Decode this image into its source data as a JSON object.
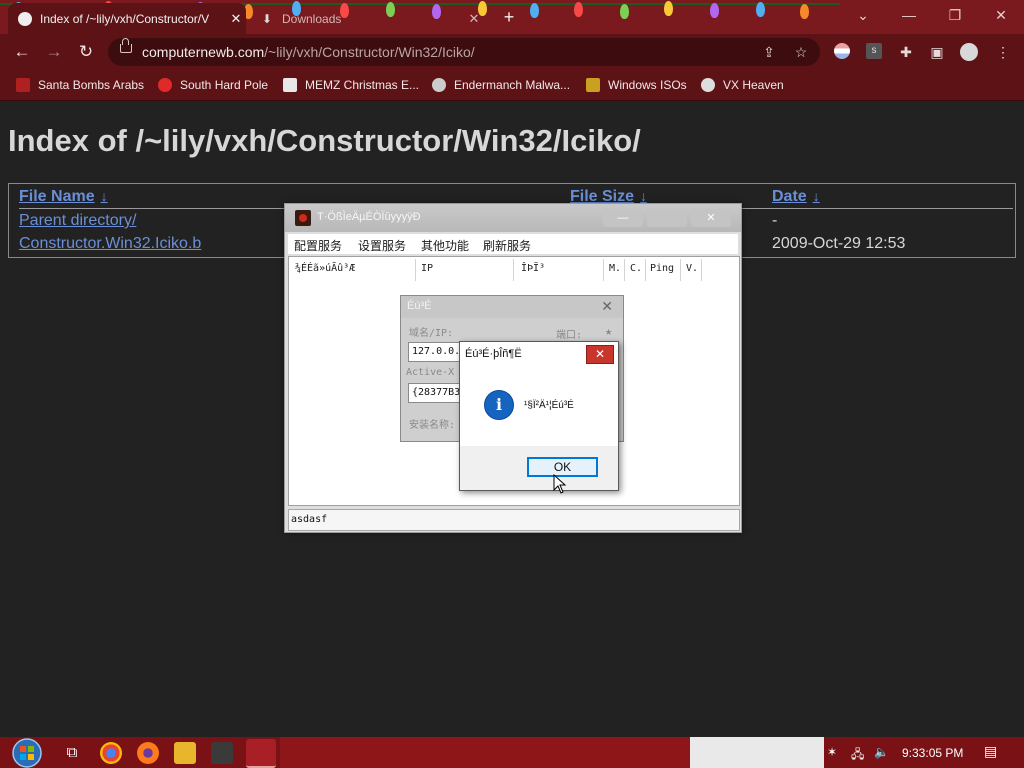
{
  "browser": {
    "tabs": [
      {
        "title": "Index of /~lily/vxh/Constructor/V",
        "active": true
      },
      {
        "title": "Downloads",
        "active": false
      }
    ],
    "new_tab": "+",
    "window_controls": {
      "chevron": "⌄",
      "minimize": "—",
      "restore": "❐",
      "close": "✕"
    },
    "nav": {
      "back": "←",
      "forward": "→",
      "reload": "↻"
    },
    "url_host": "computernewb.com",
    "url_path": "/~lily/vxh/Constructor/Win32/Iciko/",
    "bookmarks": [
      {
        "label": "Santa Bombs Arabs",
        "icon": "santa-icon",
        "color": "#b02020"
      },
      {
        "label": "South Hard Pole",
        "icon": "snowflake-icon",
        "color": "#e02a2a"
      },
      {
        "label": "MEMZ Christmas E...",
        "icon": "memz-icon",
        "color": "#e8e8e8"
      },
      {
        "label": "Endermanch Malwa...",
        "icon": "malware-icon",
        "color": "#cccccc"
      },
      {
        "label": "Windows ISOs",
        "icon": "windows-isos-icon",
        "color": "#c9a020"
      },
      {
        "label": "VX Heaven",
        "icon": "vx-heaven-icon",
        "color": "#dddddd"
      }
    ]
  },
  "page": {
    "title": "Index of /~lily/vxh/Constructor/Win32/Iciko/",
    "columns": {
      "name": "File Name",
      "size": "File Size",
      "date": "Date",
      "sort_arrow": "↓"
    },
    "rows": [
      {
        "name": "Parent directory/",
        "size": "",
        "date": "-"
      },
      {
        "name": "Constructor.Win32.Iciko.b",
        "size": "",
        "date": "2009-Oct-29 12:53"
      }
    ]
  },
  "app_window": {
    "title": "T·ÖßÌeÄµÉÒÏûyyyÿÐ",
    "menus": [
      "配置服务",
      "设置服务",
      "其他功能",
      "刷新服务"
    ],
    "columns": [
      "¾ÉÉã»úÃû³Æ",
      "IP",
      "ÎÞÏ³",
      "M.",
      "C.",
      "Ping",
      "V."
    ],
    "status_text": "asdasf"
  },
  "settings_dialog": {
    "title": "Éú³É",
    "close": "✕",
    "domain_label": "域名/IP:",
    "port_label": "端口:",
    "domain_value": "127.0.0.",
    "activex_label": "Active-X",
    "activex_value": "{28377B3",
    "install_label": "安装名称:"
  },
  "message_box": {
    "title": "Éú³É·þÎñ¶Ë",
    "close": "✕",
    "icon": "info-icon",
    "message": "¹§Ï²Ä¹¦Éú³É",
    "ok_label": "OK"
  },
  "taskbar": {
    "clock": "9:33:05 PM"
  },
  "colors": {
    "page_bg": "#222222",
    "link": "#6b8fd6",
    "chrome": "#5d1316",
    "taskbar": "#7a1215"
  }
}
